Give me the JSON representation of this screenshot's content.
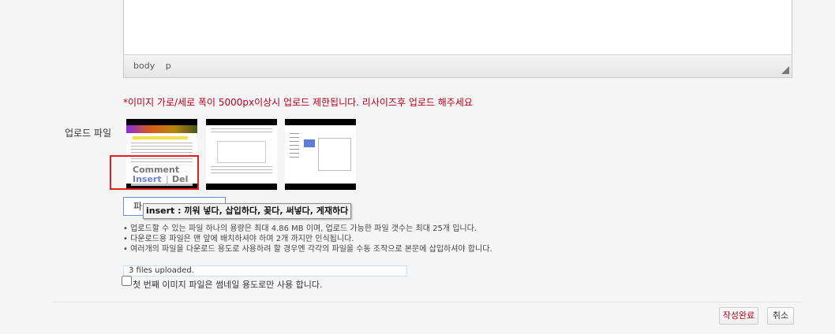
{
  "editor": {
    "statusbar_path": [
      "body",
      "p"
    ]
  },
  "notice": "*이미지 가로/세로 폭이 5000px이상시 업로드 제한됩니다. 리사이즈후 업로드 해주세요",
  "upload": {
    "label": "업로드 파일",
    "thumb_actions": {
      "comment": "Comment",
      "insert": "Insert",
      "separator": "|",
      "del": "Del"
    },
    "file_button_label": "파",
    "tooltip": "insert : 끼워 넣다, 삽입하다, 꽂다, 써넣다, 게재하다",
    "info": [
      "업로드할 수 있는 파일 하나의 용량은 최대 4.86 MB 이며, 업로드 가능한 파일 갯수는 최대 25개 입니다.",
      "다운로드용 파일은 맨 앞에 배치하셔야 하며 2개 까지만 인식됩니다.",
      "여러개의 파일을 다운로드 용도로 사용하려 할 경우엔 각각의 파일을 수동 조작으로 본문에 삽입하셔야 합니다."
    ],
    "status": "3 files uploaded.",
    "thumbnail_checkbox_label": "첫 번째 이미지 파일은 썸네일 용도로만 사용 합니다.",
    "thumbnail_checkbox_checked": false
  },
  "actions": {
    "submit": "작성완료",
    "cancel": "취소"
  },
  "colors": {
    "notice": "#b3001b",
    "highlight": "#e02020",
    "insert_link": "#6c7fd8"
  }
}
